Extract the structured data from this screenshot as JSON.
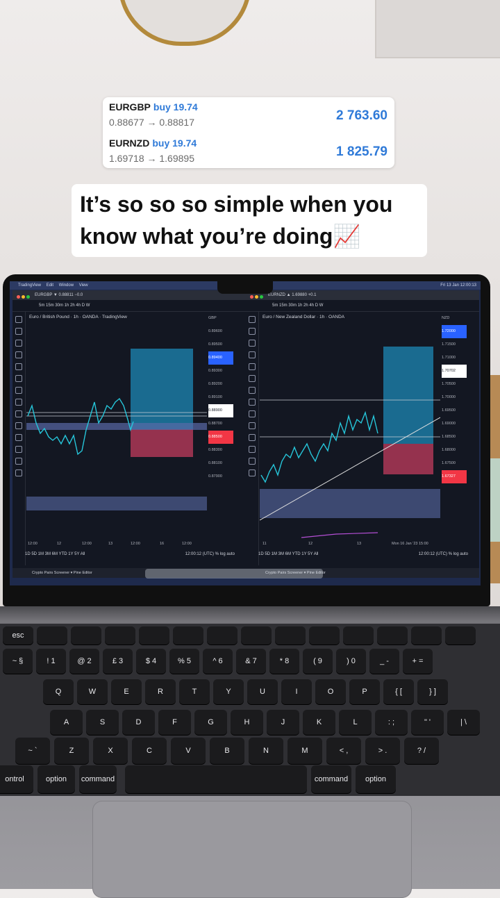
{
  "trade_card": {
    "trades": [
      {
        "pair": "EURGBP",
        "side": "buy 19.74",
        "prices": "0.88677 → 0.88817",
        "profit": "2 763.60"
      },
      {
        "pair": "EURNZD",
        "side": "buy 19.74",
        "prices": "1.69718 → 1.69895",
        "profit": "1 825.79"
      }
    ]
  },
  "caption": {
    "line1": "It’s so so so simple when you",
    "line2": "know what you’re doing📈"
  },
  "macos_menubar": {
    "app": "TradingView",
    "menu_edit": "Edit",
    "menu_window": "Window",
    "menu_view": "View",
    "clock": "Fri 13 Jan 12:00:13"
  },
  "left_window": {
    "tab": "EURGBP ▼ 0.88811 −0.0",
    "timeframes": "5m 15m 30m 1h 2h 4h D W",
    "symbol_title": "Euro / British Pound · 1h · OANDA · TradingView",
    "currency": "GBP",
    "price_axis": [
      "0.89600",
      "0.89500",
      "0.89400",
      "0.89300",
      "0.89200",
      "0.89100",
      "0.89000",
      "0.88900",
      "0.88800",
      "0.88700",
      "0.88600",
      "0.88500",
      "0.88400",
      "0.88300",
      "0.88200",
      "0.88100",
      "0.88000",
      "0.87900",
      "0.87800"
    ],
    "time_axis": [
      "12:00",
      "12",
      "12:00",
      "13",
      "12:00",
      "16",
      "12:00"
    ],
    "ranges": "1D 5D 1M 3M 6M YTD 1Y 5Y All",
    "clock": "12:00:12 (UTC)",
    "scale": "% log auto",
    "status": "Crypto Pairs Screener ▾   Pine Editor"
  },
  "right_window": {
    "tab": "EURNZD ▲ 1.69880 +0.1",
    "timeframes": "5m 15m 30m 1h 2h 4h D W",
    "symbol_title": "Euro / New Zealand Dollar · 1h · OANDA",
    "currency": "NZD",
    "price_axis": [
      "1.72000",
      "1.71500",
      "1.71000",
      "1.70702",
      "1.70500",
      "1.70000",
      "1.69500",
      "1.69000",
      "1.68500",
      "1.68000",
      "1.67500",
      "1.67327"
    ],
    "time_axis": [
      "11",
      "12",
      "13",
      "Mon 16 Jan '23  15:00"
    ],
    "ranges": "1D 5D 1M 3M 6M YTD 1Y 5Y All",
    "clock": "12:00:12 (UTC)",
    "scale": "% log auto",
    "status": "Crypto Pairs Screener ▾   Pine Editor"
  },
  "keyboard": {
    "esc": "esc",
    "number_row": [
      "~ §",
      "! 1",
      "@ 2",
      "£ 3",
      "$ 4",
      "% 5",
      "^ 6",
      "& 7",
      "* 8",
      "( 9",
      ") 0",
      "_ -",
      "+ ="
    ],
    "row_q": [
      "Q",
      "W",
      "E",
      "R",
      "T",
      "Y",
      "U",
      "I",
      "O",
      "P",
      "{ [",
      "} ]"
    ],
    "row_a": [
      "A",
      "S",
      "D",
      "F",
      "G",
      "H",
      "J",
      "K",
      "L",
      ": ;",
      "\" '",
      "| \\"
    ],
    "row_z": [
      "~ `",
      "Z",
      "X",
      "C",
      "V",
      "B",
      "N",
      "M",
      "< ,",
      "> .",
      "? /"
    ],
    "bottom_left": [
      "ontrol",
      "option",
      "command"
    ],
    "bottom_right": [
      "command",
      "option"
    ]
  }
}
